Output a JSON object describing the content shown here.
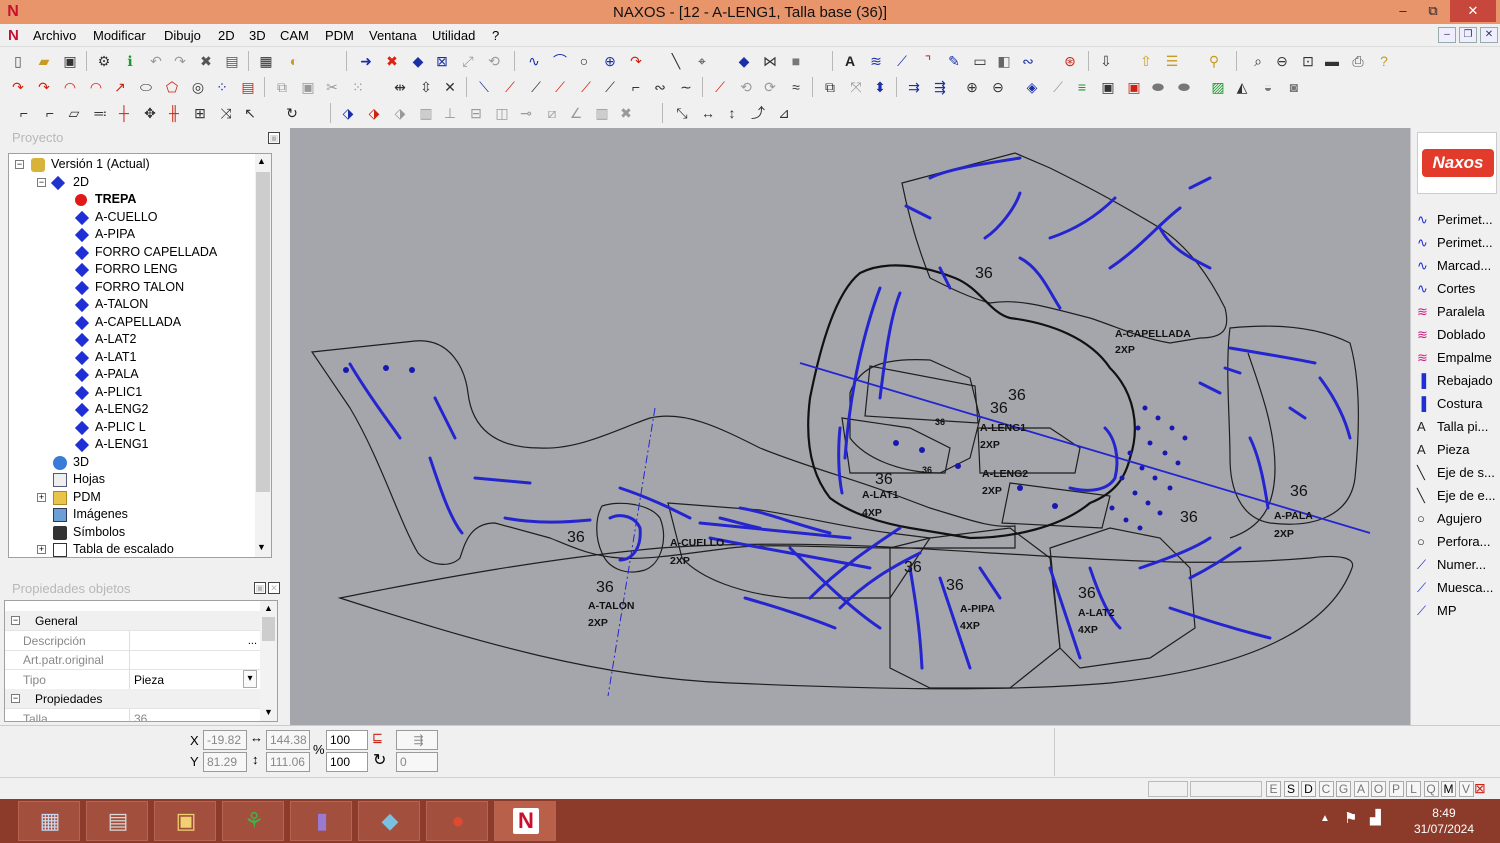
{
  "window": {
    "title": "NAXOS - [12 - A-LENG1, Talla base (36)]",
    "controls": {
      "minimize": "–",
      "maximize": "⧉",
      "close": "✕"
    }
  },
  "menu": [
    "Archivo",
    "Modificar",
    "Dibujo",
    "2D",
    "3D",
    "CAM",
    "PDM",
    "Ventana",
    "Utilidad",
    "?"
  ],
  "project_panel": {
    "title": "Proyecto",
    "tree": [
      {
        "label": "Versión 1 (Actual)",
        "level": 0,
        "icon": "version-icon",
        "expander": "−"
      },
      {
        "label": "2D",
        "level": 1,
        "icon": "2d-icon",
        "expander": "−"
      },
      {
        "label": "TREPA",
        "level": 2,
        "icon": "red-dot-icon",
        "bold": true
      },
      {
        "label": "A-CUELLO",
        "level": 2,
        "icon": "blue-diamond-icon"
      },
      {
        "label": "A-PIPA",
        "level": 2,
        "icon": "blue-diamond-icon"
      },
      {
        "label": "FORRO CAPELLADA",
        "level": 2,
        "icon": "blue-diamond-icon"
      },
      {
        "label": "FORRO LENG",
        "level": 2,
        "icon": "blue-diamond-icon"
      },
      {
        "label": "FORRO TALON",
        "level": 2,
        "icon": "blue-diamond-icon"
      },
      {
        "label": "A-TALON",
        "level": 2,
        "icon": "blue-diamond-icon"
      },
      {
        "label": "A-CAPELLADA",
        "level": 2,
        "icon": "blue-diamond-icon"
      },
      {
        "label": "A-LAT2",
        "level": 2,
        "icon": "blue-diamond-icon"
      },
      {
        "label": "A-LAT1",
        "level": 2,
        "icon": "blue-diamond-icon"
      },
      {
        "label": "A-PALA",
        "level": 2,
        "icon": "blue-diamond-icon"
      },
      {
        "label": "A-PLIC1",
        "level": 2,
        "icon": "blue-diamond-icon"
      },
      {
        "label": "A-LENG2",
        "level": 2,
        "icon": "blue-diamond-icon"
      },
      {
        "label": "A-PLIC L",
        "level": 2,
        "icon": "blue-diamond-icon"
      },
      {
        "label": "A-LENG1",
        "level": 2,
        "icon": "blue-diamond-icon"
      },
      {
        "label": "3D",
        "level": 1,
        "icon": "3d-icon"
      },
      {
        "label": "Hojas",
        "level": 1,
        "icon": "sheets-icon"
      },
      {
        "label": "PDM",
        "level": 1,
        "icon": "folder-icon",
        "expander": "+"
      },
      {
        "label": "Imágenes",
        "level": 1,
        "icon": "images-icon"
      },
      {
        "label": "Símbolos",
        "level": 1,
        "icon": "symbols-icon"
      },
      {
        "label": "Tabla de escalado",
        "level": 1,
        "icon": "table-icon",
        "expander": "+"
      }
    ]
  },
  "properties_panel": {
    "title": "Propiedades objetos",
    "rows": [
      {
        "type": "category",
        "label": "General",
        "expander": "−"
      },
      {
        "type": "field",
        "label": "Descripción",
        "value": "",
        "button": "..."
      },
      {
        "type": "field",
        "label": "Art.patr.original",
        "value": ""
      },
      {
        "type": "field",
        "label": "Tipo",
        "value": "Pieza",
        "dropdown": "▾"
      },
      {
        "type": "category",
        "label": "Propiedades",
        "expander": "−"
      },
      {
        "type": "field",
        "label": "Talla",
        "value": "36"
      }
    ]
  },
  "canvas": {
    "labels": [
      {
        "text": "36",
        "size": "big"
      },
      {
        "text": "A-CAPELLADA",
        "size": "small"
      },
      {
        "text": "2XP",
        "size": "small"
      },
      {
        "text": "36",
        "size": "big"
      },
      {
        "text": "36",
        "size": "big"
      },
      {
        "text": "A-LENG1",
        "size": "small"
      },
      {
        "text": "2XP",
        "size": "small"
      },
      {
        "text": "36",
        "size": "tiny"
      },
      {
        "text": "36",
        "size": "tiny"
      },
      {
        "text": "36",
        "size": "big"
      },
      {
        "text": "A-LAT1",
        "size": "small"
      },
      {
        "text": "4XP",
        "size": "small"
      },
      {
        "text": "A-LENG2",
        "size": "small"
      },
      {
        "text": "2XP",
        "size": "small"
      },
      {
        "text": "36",
        "size": "big"
      },
      {
        "text": "A-CUELLO",
        "size": "small"
      },
      {
        "text": "2XP",
        "size": "small"
      },
      {
        "text": "36",
        "size": "big"
      },
      {
        "text": "A-TALON",
        "size": "small"
      },
      {
        "text": "2XP",
        "size": "small"
      },
      {
        "text": "36",
        "size": "big"
      },
      {
        "text": "36",
        "size": "big"
      },
      {
        "text": "A-PIPA",
        "size": "small"
      },
      {
        "text": "4XP",
        "size": "small"
      },
      {
        "text": "36",
        "size": "big"
      },
      {
        "text": "A-LAT2",
        "size": "small"
      },
      {
        "text": "4XP",
        "size": "small"
      },
      {
        "text": "36",
        "size": "big"
      },
      {
        "text": "36",
        "size": "big"
      },
      {
        "text": "A-PALA",
        "size": "small"
      },
      {
        "text": "2XP",
        "size": "small"
      }
    ]
  },
  "right_panel": {
    "logo": "Naxos",
    "tools": [
      {
        "label": "Perimet...",
        "icon": "curve-icon"
      },
      {
        "label": "Perimet...",
        "icon": "curve-icon"
      },
      {
        "label": "Marcad...",
        "icon": "curve-icon"
      },
      {
        "label": "Cortes",
        "icon": "curve-icon"
      },
      {
        "label": "Paralela",
        "icon": "parallel-icon"
      },
      {
        "label": "Doblado",
        "icon": "fold-icon"
      },
      {
        "label": "Empalme",
        "icon": "splice-icon"
      },
      {
        "label": "Rebajado",
        "icon": "skive-icon"
      },
      {
        "label": "Costura",
        "icon": "seam-icon"
      },
      {
        "label": "Talla pi...",
        "icon": "text-a-icon"
      },
      {
        "label": "Pieza",
        "icon": "text-a-icon"
      },
      {
        "label": "Eje de s...",
        "icon": "axis-icon"
      },
      {
        "label": "Eje de e...",
        "icon": "axis-icon"
      },
      {
        "label": "Agujero",
        "icon": "circle-icon"
      },
      {
        "label": "Perfora...",
        "icon": "circle-icon"
      },
      {
        "label": "Numer...",
        "icon": "number-icon"
      },
      {
        "label": "Muesca...",
        "icon": "notch-icon"
      },
      {
        "label": "MP",
        "icon": "mp-icon"
      }
    ]
  },
  "coordinates": {
    "x_label": "X",
    "y_label": "Y",
    "x": "-19.82",
    "y": "81.29",
    "width": "144.38",
    "height": "111.06",
    "scale_x": "100",
    "scale_y": "100",
    "percent": "%",
    "rotation": "0"
  },
  "statusbar": {
    "letters": [
      "E",
      "S",
      "D",
      "C",
      "G",
      "A",
      "O",
      "P",
      "L",
      "Q",
      "M",
      "V"
    ]
  },
  "taskbar": {
    "apps": [
      {
        "name": "calculator",
        "glyph": "▦"
      },
      {
        "name": "explorer-files",
        "glyph": "▤"
      },
      {
        "name": "file-explorer",
        "glyph": "▣"
      },
      {
        "name": "green-app",
        "glyph": "⚘"
      },
      {
        "name": "purple-app",
        "glyph": "▮"
      },
      {
        "name": "blue-app",
        "glyph": "◆"
      },
      {
        "name": "chrome",
        "glyph": "●"
      },
      {
        "name": "naxos",
        "glyph": "N"
      }
    ],
    "time": "8:49",
    "date": "31/07/2024"
  },
  "colors": {
    "titlebar": "#e8956c",
    "canvas": "#a5a6ac",
    "pattern_blue": "#2525d0",
    "taskbar": "#8c3b2b",
    "tree_diamond": "#1f2fd6"
  }
}
